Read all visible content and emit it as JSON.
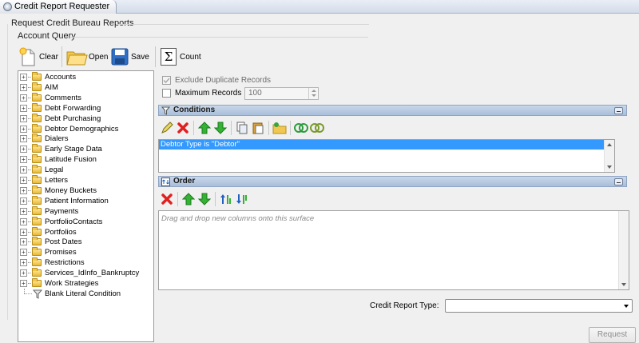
{
  "window": {
    "title": "Credit Report Requester"
  },
  "group_title": "Request Credit Bureau Reports",
  "account_query": {
    "title": "Account Query",
    "toolbar": {
      "clear_label": "Clear",
      "open_label": "Open",
      "save_label": "Save",
      "count_label": "Count"
    }
  },
  "tree": {
    "items": [
      {
        "label": "Accounts",
        "expandable": true
      },
      {
        "label": "AIM",
        "expandable": true
      },
      {
        "label": "Comments",
        "expandable": true
      },
      {
        "label": "Debt Forwarding",
        "expandable": true
      },
      {
        "label": "Debt Purchasing",
        "expandable": true
      },
      {
        "label": "Debtor Demographics",
        "expandable": true
      },
      {
        "label": "Dialers",
        "expandable": true
      },
      {
        "label": "Early Stage Data",
        "expandable": true
      },
      {
        "label": "Latitude Fusion",
        "expandable": true
      },
      {
        "label": "Legal",
        "expandable": true
      },
      {
        "label": "Letters",
        "expandable": true
      },
      {
        "label": "Money Buckets",
        "expandable": true
      },
      {
        "label": "Patient Information",
        "expandable": true
      },
      {
        "label": "Payments",
        "expandable": true
      },
      {
        "label": "PortfolioContacts",
        "expandable": true
      },
      {
        "label": "Portfolios",
        "expandable": true
      },
      {
        "label": "Post Dates",
        "expandable": true
      },
      {
        "label": "Promises",
        "expandable": true
      },
      {
        "label": "Restrictions",
        "expandable": true
      },
      {
        "label": "Services_IdInfo_Bankruptcy",
        "expandable": true
      },
      {
        "label": "Work Strategies",
        "expandable": true
      },
      {
        "label": "Blank Literal Condition",
        "expandable": false
      }
    ]
  },
  "options": {
    "exclude_duplicates_label": "Exclude Duplicate Records",
    "exclude_duplicates_checked": true,
    "max_records_label": "Maximum Records",
    "max_records_checked": false,
    "max_records_value": "100"
  },
  "conditions": {
    "title": "Conditions",
    "rows": [
      "Debtor Type is \"Debtor\""
    ]
  },
  "order": {
    "title": "Order",
    "placeholder": "Drag and drop new columns onto this surface"
  },
  "credit_report_type": {
    "label": "Credit Report Type:",
    "value": ""
  },
  "request_button_label": "Request",
  "colors": {
    "selection": "#3399ff",
    "panel_header": "#b9cbe2",
    "delete_red": "#e02020",
    "arrow_green": "#2fa82f"
  }
}
